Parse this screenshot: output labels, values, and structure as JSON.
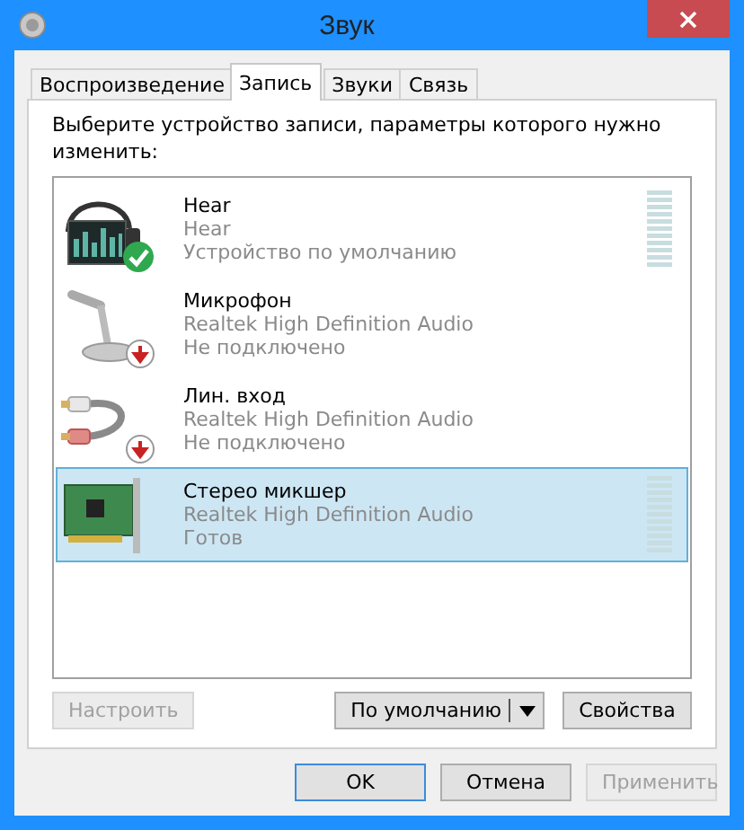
{
  "window": {
    "title": "Звук"
  },
  "tabs": [
    {
      "label": "Воспроизведение",
      "selected": false
    },
    {
      "label": "Запись",
      "selected": true
    },
    {
      "label": "Звуки",
      "selected": false
    },
    {
      "label": "Связь",
      "selected": false
    }
  ],
  "instruction": "Выберите устройство записи, параметры которого нужно изменить:",
  "devices": [
    {
      "kind": "headset",
      "name": "Hear",
      "driver": "Hear",
      "status": "Устройство по умолчанию",
      "is_default": true,
      "unplugged": false,
      "meter": true,
      "selected": false
    },
    {
      "kind": "microphone",
      "name": "Микрофон",
      "driver": "Realtek High Definition Audio",
      "status": "Не подключено",
      "is_default": false,
      "unplugged": true,
      "meter": false,
      "selected": false
    },
    {
      "kind": "line-in",
      "name": "Лин. вход",
      "driver": "Realtek High Definition Audio",
      "status": "Не подключено",
      "is_default": false,
      "unplugged": true,
      "meter": false,
      "selected": false
    },
    {
      "kind": "card",
      "name": "Стерео микшер",
      "driver": "Realtek High Definition Audio",
      "status": "Готов",
      "is_default": false,
      "unplugged": false,
      "meter": true,
      "selected": true
    }
  ],
  "panel_buttons": {
    "configure": {
      "label": "Настроить",
      "disabled": true
    },
    "set_default": {
      "label": "По умолчанию",
      "disabled": false
    },
    "properties": {
      "label": "Свойства",
      "disabled": false
    }
  },
  "dialog_buttons": [
    {
      "label": "OK",
      "disabled": false,
      "default": true
    },
    {
      "label": "Отмена",
      "disabled": false,
      "default": false
    },
    {
      "label": "Применить",
      "disabled": true,
      "default": false
    }
  ]
}
